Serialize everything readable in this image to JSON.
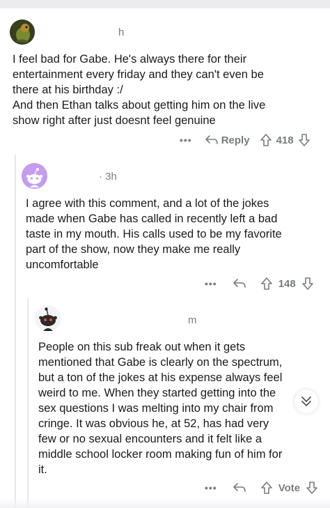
{
  "comments": [
    {
      "username": "h",
      "time": "",
      "body_lines": [
        "I feel bad for Gabe. He's always there for their",
        "entertainment every friday and they can't even be",
        "there at his birthday :/",
        "And then Ethan talks about getting him on the live",
        "show right after just doesnt feel genuine"
      ],
      "reply_label": "Reply",
      "votes": "418"
    },
    {
      "username": "",
      "time": "· 3h",
      "body_lines": [
        "I agree with this comment, and a lot of the jokes",
        "made when Gabe has called in recently left a bad",
        "taste in my mouth. His calls used to be my favorite",
        "part of the show, now they make me really",
        "uncomfortable"
      ],
      "votes": "148"
    },
    {
      "username": "",
      "time": "m",
      "body_lines": [
        "People on this sub freak out when it gets",
        "mentioned that Gabe is clearly on the spectrum,",
        "but a ton of the jokes at his expense always feel",
        "weird to me. When they started getting into the",
        "sex questions I was melting into my chair from",
        "cringe. It was obvious he, at 52, has had very",
        "few or no sexual encounters and it felt like a",
        "middle school locker room making fun of him for",
        "it."
      ],
      "votes": "Vote"
    }
  ],
  "icons": {
    "more": "more-dots-icon",
    "reply": "reply-arrow-icon",
    "upvote": "upvote-arrow-icon",
    "downvote": "downvote-arrow-icon",
    "collapse": "chevron-double-down-icon"
  },
  "colors": {
    "text": "#1a1a1b",
    "meta": "#787c7e",
    "thread": "#e6e6e8",
    "avatar_purple": "#c59cf0",
    "snoo_dark": "#2a2a2a"
  }
}
